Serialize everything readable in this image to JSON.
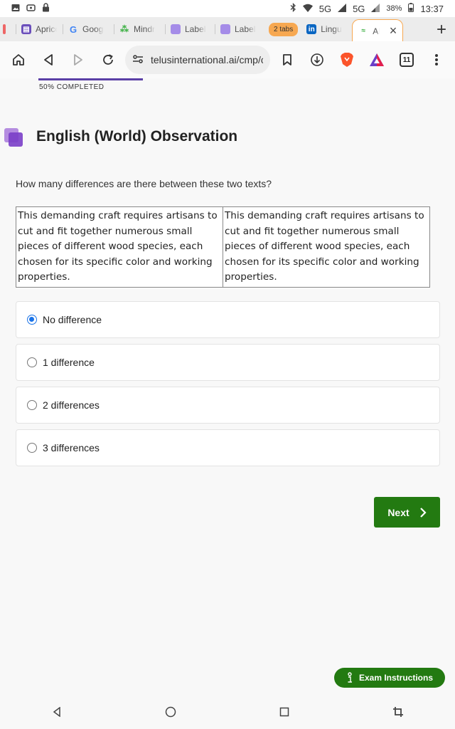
{
  "status_bar": {
    "network": "5G",
    "network2": "5G",
    "battery": "38%",
    "time": "13:37"
  },
  "tabs": [
    {
      "label": "Apricot",
      "favicon": "apricot-icon",
      "color": "#6b4fbb"
    },
    {
      "label": "Google",
      "favicon": "google-icon",
      "color": "#4285f4"
    },
    {
      "label": "Mindrift",
      "favicon": "mindrift-icon",
      "color": "#3cb043"
    },
    {
      "label": "Labelbox",
      "favicon": "label-icon",
      "color": "#a58ce8"
    },
    {
      "label": "Labelbox",
      "favicon": "label-icon",
      "color": "#a58ce8"
    }
  ],
  "tab_group": "2 tabs",
  "tab_linkedin": {
    "label": "Linguist",
    "favicon": "linkedin-icon"
  },
  "active_tab": {
    "label": "AI",
    "favicon": "telus-icon"
  },
  "toolbar": {
    "url": "telusinternational.ai/cmp/cc",
    "tab_count": "11"
  },
  "progress": {
    "value": 0.5,
    "label": "50% COMPLETED"
  },
  "page": {
    "title": "English (World) Observation",
    "question": "How many differences are there between these two texts?",
    "text_a": "This demanding craft requires artisans to cut and fit together numerous small pieces of different wood species, each chosen for its specific color and working properties.",
    "text_b": "This demanding craft requires artisans to cut and fit together numerous small pieces of different wood species, each chosen for its specific color and working properties."
  },
  "options": [
    {
      "label": "No difference",
      "checked": true
    },
    {
      "label": "1 difference",
      "checked": false
    },
    {
      "label": "2 differences",
      "checked": false
    },
    {
      "label": "3 differences",
      "checked": false
    }
  ],
  "buttons": {
    "next": "Next",
    "exam_instructions": "Exam Instructions"
  },
  "colors": {
    "accent_green": "#237a11",
    "progress_purple": "#5b3fa6",
    "radio_blue": "#1a73e8",
    "tab_group_orange": "#f7a851"
  }
}
